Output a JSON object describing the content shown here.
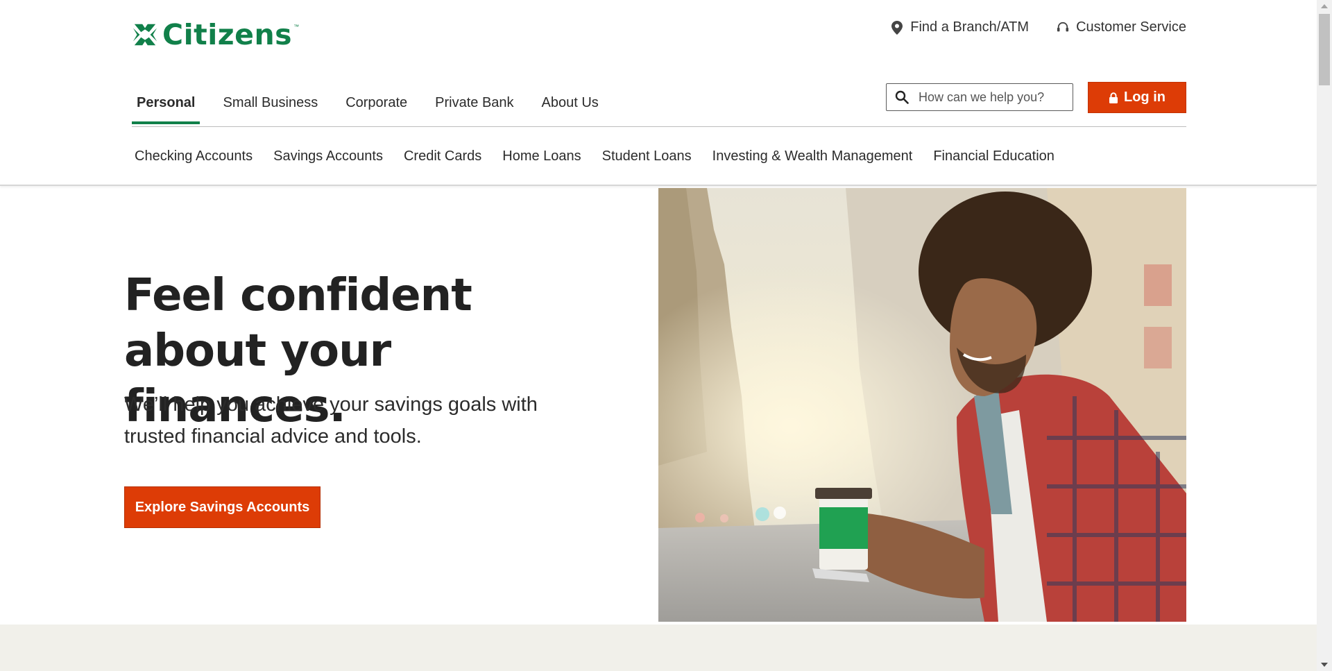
{
  "brand": {
    "name": "Citizens",
    "trademark": "™",
    "color": "#11804a",
    "accent": "#dd3c06"
  },
  "utility": {
    "branch": {
      "icon": "location-pin-icon",
      "label": "Find a Branch/ATM"
    },
    "service": {
      "icon": "headset-icon",
      "label": "Customer Service"
    }
  },
  "primary_nav": [
    {
      "label": "Personal",
      "active": true
    },
    {
      "label": "Small Business"
    },
    {
      "label": "Corporate"
    },
    {
      "label": "Private Bank"
    },
    {
      "label": "About Us"
    }
  ],
  "search": {
    "placeholder": "How can we help you?",
    "value": ""
  },
  "login": {
    "icon": "lock-icon",
    "label": "Log in"
  },
  "secondary_nav": [
    "Checking Accounts",
    "Savings Accounts",
    "Credit Cards",
    "Home Loans",
    "Student Loans",
    "Investing & Wealth Management",
    "Financial Education"
  ],
  "hero": {
    "title": "Feel confident about your finances.",
    "subtitle": "We’ll help you achieve your savings goals with trusted financial advice and tools.",
    "cta": "Explore Savings Accounts",
    "image_alt": "Man with curly hair smiling at his phone while holding a green coffee cup on a city street"
  }
}
